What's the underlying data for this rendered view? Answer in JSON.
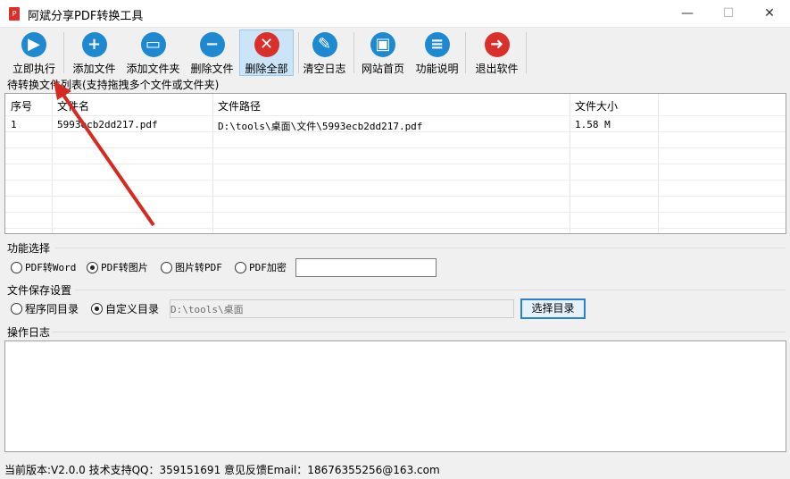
{
  "window": {
    "title": "阿斌分享PDF转换工具",
    "minimize": "—",
    "maximize": "☐",
    "close": "✕"
  },
  "toolbar": [
    {
      "label": "立即执行",
      "icon": "play-icon",
      "glyph": "▶",
      "color": "#1e88d0"
    },
    {
      "label": "添加文件",
      "icon": "plus-icon",
      "glyph": "+",
      "color": "#1e88d0"
    },
    {
      "label": "添加文件夹",
      "icon": "folder-icon",
      "glyph": "▭",
      "color": "#1e88d0"
    },
    {
      "label": "删除文件",
      "icon": "minus-icon",
      "glyph": "−",
      "color": "#1e88d0"
    },
    {
      "label": "删除全部",
      "icon": "x-icon",
      "glyph": "✕",
      "color": "#d9302c"
    },
    {
      "label": "清空日志",
      "icon": "broom-icon",
      "glyph": "✎",
      "color": "#1e88d0"
    },
    {
      "label": "网站首页",
      "icon": "monitor-icon",
      "glyph": "▣",
      "color": "#1e88d0"
    },
    {
      "label": "功能说明",
      "icon": "document-icon",
      "glyph": "≡",
      "color": "#1e88d0"
    },
    {
      "label": "退出软件",
      "icon": "exit-icon",
      "glyph": "➜",
      "color": "#d9302c"
    }
  ],
  "file_list": {
    "label": "待转换文件列表(支持拖拽多个文件或文件夹)",
    "columns": [
      "序号",
      "文件名",
      "文件路径",
      "文件大小"
    ],
    "rows": [
      [
        "1",
        "5993ecb2dd217.pdf",
        "D:\\tools\\桌面\\文件\\5993ecb2dd217.pdf",
        "1.58 M"
      ]
    ]
  },
  "function": {
    "label": "功能选择",
    "options": [
      "PDF转Word",
      "PDF转图片",
      "图片转PDF",
      "PDF加密"
    ],
    "selected": 1,
    "password": ""
  },
  "save": {
    "label": "文件保存设置",
    "options": [
      "程序同目录",
      "自定义目录"
    ],
    "selected": 1,
    "path": "D:\\tools\\桌面",
    "browse": "选择目录"
  },
  "log": {
    "label": "操作日志",
    "content": ""
  },
  "status": "当前版本:V2.0.0  技术支持QQ：359151691  意见反馈Email：18676355256@163.com"
}
